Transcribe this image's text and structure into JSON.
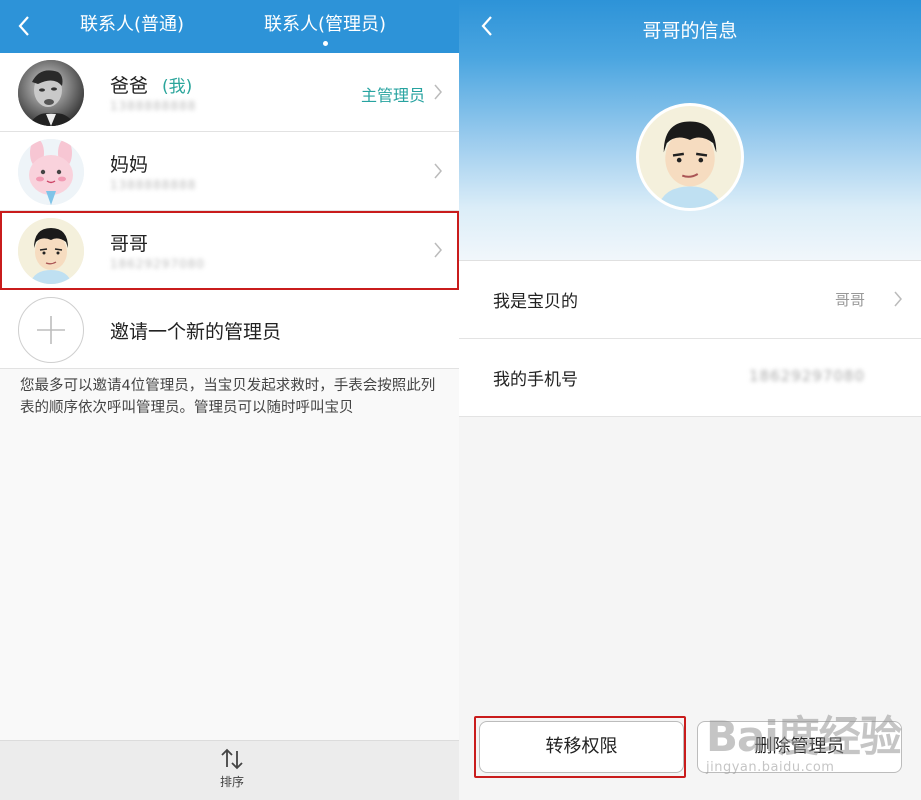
{
  "left": {
    "tabs": [
      {
        "label": "联系人(普通)"
      },
      {
        "label": "联系人(管理员)"
      }
    ],
    "contacts": [
      {
        "name": "爸爸",
        "me_tag": "(我)",
        "phone": "1388888888",
        "role": "主管理员"
      },
      {
        "name": "妈妈",
        "phone": "1388888888",
        "role": ""
      },
      {
        "name": "哥哥",
        "phone": "18629297080",
        "role": ""
      }
    ],
    "invite_label": "邀请一个新的管理员",
    "note": "您最多可以邀请4位管理员，当宝贝发起求救时，手表会按照此列表的顺序依次呼叫管理员。管理员可以随时呼叫宝贝",
    "sort_label": "排序"
  },
  "right": {
    "title": "哥哥的信息",
    "relation_label": "我是宝贝的",
    "relation_value": "哥哥",
    "phone_label": "我的手机号",
    "phone_value": "18629297080",
    "transfer_button": "转移权限",
    "delete_button": "删除管理员"
  },
  "watermark": {
    "main": "Bai度经验",
    "sub": "jingyan.baidu.com"
  },
  "colors": {
    "header_blue": "#2d93d8",
    "accent_teal": "#27a3a0",
    "highlight_red": "#c91c1c"
  }
}
